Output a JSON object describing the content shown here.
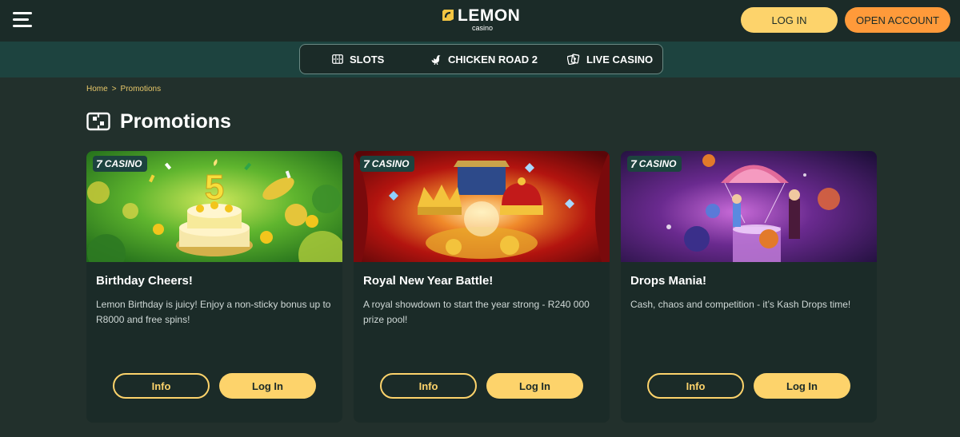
{
  "header": {
    "logo_text": "LEMON",
    "logo_sub": "casino",
    "login_label": "LOG IN",
    "open_account_label": "OPEN ACCOUNT"
  },
  "nav": {
    "items": [
      {
        "label": "SLOTS",
        "icon": "slots-icon"
      },
      {
        "label": "CHICKEN ROAD 2",
        "icon": "chicken-icon"
      },
      {
        "label": "LIVE CASINO",
        "icon": "cards-icon"
      }
    ]
  },
  "breadcrumb": {
    "home": "Home",
    "separator": ">",
    "current": "Promotions"
  },
  "page": {
    "title": "Promotions"
  },
  "cards": [
    {
      "badge_seven": "7",
      "badge": "CASINO",
      "title": "Birthday Cheers!",
      "description": "Lemon Birthday is juicy! Enjoy a non-sticky bonus up to R8000 and free spins!",
      "image_text": "5",
      "info_label": "Info",
      "login_label": "Log In"
    },
    {
      "badge_seven": "7",
      "badge": "CASINO",
      "title": "Royal New Year Battle!",
      "description": "A royal showdown to start the year strong - R240 000 prize pool!",
      "info_label": "Info",
      "login_label": "Log In"
    },
    {
      "badge_seven": "7",
      "badge": "CASINO",
      "title": "Drops Mania!",
      "description": "Cash, chaos and competition - it’s Kash Drops time!",
      "info_label": "Info",
      "login_label": "Log In"
    }
  ],
  "colors": {
    "background": "#22302c",
    "header": "#1b2b28",
    "nav_band": "#1d433f",
    "accent_yellow": "#fdd36b",
    "accent_orange": "#ff9a3a",
    "breadcrumb": "#e8c86a"
  }
}
